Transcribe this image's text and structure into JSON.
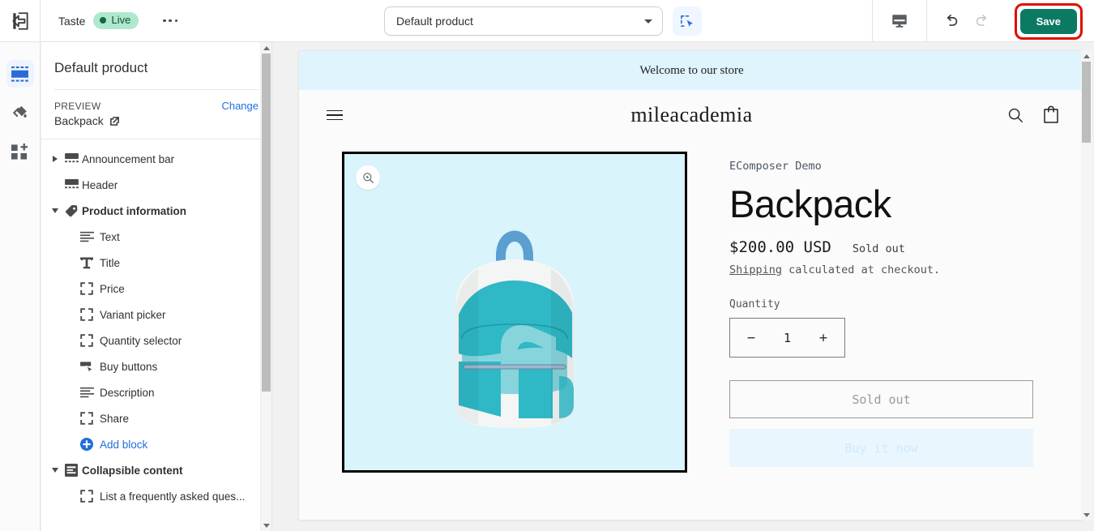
{
  "topbar": {
    "exit_icon": "exit-to-app-icon",
    "shop_name": "Taste",
    "status_label": "Live",
    "more_icon": "ellipsis-icon",
    "product_selector_value": "Default product",
    "product_selector_caret": "chevron-down-icon",
    "inspector_icon": "select-element-icon",
    "device_icon": "desktop-icon",
    "undo_icon": "undo-icon",
    "redo_icon": "redo-icon",
    "save_label": "Save",
    "save_color": "#0c7a63",
    "highlight_color": "#e00f00"
  },
  "rail": {
    "items": [
      {
        "name": "sections-icon",
        "active": true
      },
      {
        "name": "theme-settings-paint-icon",
        "active": false
      },
      {
        "name": "apps-icon",
        "active": false
      }
    ]
  },
  "sidebar": {
    "title": "Default product",
    "preview_label": "PREVIEW",
    "change_label": "Change",
    "preview_value": "Backpack",
    "external_link_icon": "external-link-icon",
    "items": [
      {
        "label": "Announcement bar",
        "icon": "section-icon",
        "toggle": "right",
        "depth": 0
      },
      {
        "label": "Header",
        "icon": "section-icon",
        "toggle": "none",
        "depth": 0
      },
      {
        "label": "Product information",
        "icon": "tag-icon",
        "toggle": "down",
        "depth": 0,
        "bold": true
      },
      {
        "label": "Text",
        "icon": "text-lines-icon",
        "toggle": "none",
        "depth": 1
      },
      {
        "label": "Title",
        "icon": "title-t-icon",
        "toggle": "none",
        "depth": 1
      },
      {
        "label": "Price",
        "icon": "block-brackets-icon",
        "toggle": "none",
        "depth": 1
      },
      {
        "label": "Variant picker",
        "icon": "block-brackets-icon",
        "toggle": "none",
        "depth": 1
      },
      {
        "label": "Quantity selector",
        "icon": "block-brackets-icon",
        "toggle": "none",
        "depth": 1
      },
      {
        "label": "Buy buttons",
        "icon": "buy-button-cursor-icon",
        "toggle": "none",
        "depth": 1
      },
      {
        "label": "Description",
        "icon": "text-lines-icon",
        "toggle": "none",
        "depth": 1
      },
      {
        "label": "Share",
        "icon": "block-brackets-icon",
        "toggle": "none",
        "depth": 1
      },
      {
        "label": "Add block",
        "icon": "plus-circle-icon",
        "toggle": "none",
        "depth": 1,
        "link": true
      },
      {
        "label": "Collapsible content",
        "icon": "collapsible-content-icon",
        "toggle": "down",
        "depth": 0,
        "bold": true
      },
      {
        "label": "List a frequently asked ques...",
        "icon": "block-brackets-icon",
        "toggle": "none",
        "depth": 1
      }
    ],
    "scroll_up_icon": "scroll-up-arrow-icon",
    "scroll_down_icon": "scroll-down-arrow-icon"
  },
  "preview": {
    "announcement": "Welcome to our store",
    "announcement_bg": "#dff4fd",
    "menu_icon": "hamburger-menu-icon",
    "logo": "mileacademia",
    "search_icon": "search-icon",
    "cart_icon": "cart-icon",
    "gallery": {
      "zoom_icon": "zoom-in-icon",
      "background": "#d9f4fb",
      "product_image_alt": "backpack"
    },
    "product": {
      "vendor": "EComposer Demo",
      "title": "Backpack",
      "price": "$200.00 USD",
      "availability": "Sold out",
      "shipping_link": "Shipping",
      "shipping_text": " calculated at checkout.",
      "quantity_label": "Quantity",
      "quantity_value": "1",
      "quantity_minus": "−",
      "quantity_plus": "+",
      "primary_button": "Sold out",
      "secondary_button": "Buy it now"
    },
    "scroll_up_icon": "scroll-up-arrow-icon",
    "scroll_down_icon": "scroll-down-arrow-icon"
  }
}
